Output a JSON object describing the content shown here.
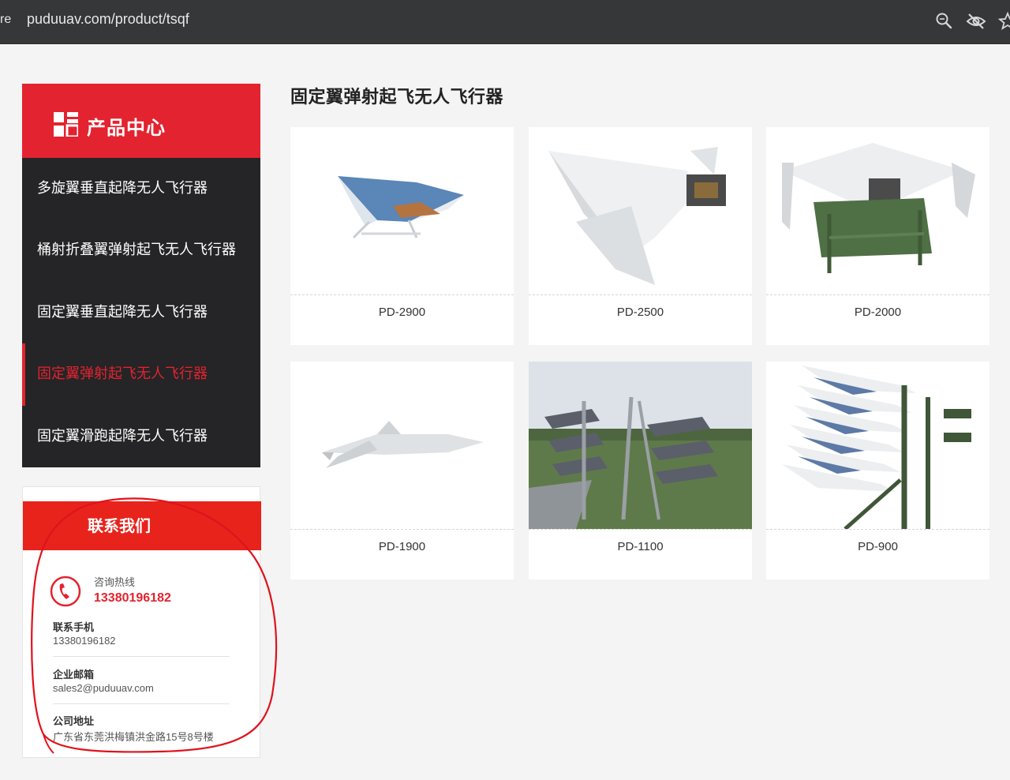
{
  "browser": {
    "url_fragment": "re",
    "url": "puduuav.com/product/tsqf",
    "icons": [
      "zoom-icon",
      "eye-off-icon",
      "bookmark-star-icon"
    ]
  },
  "sidebar": {
    "title": "产品中心",
    "items": [
      {
        "label": "多旋翼垂直起降无人飞行器",
        "active": false
      },
      {
        "label": "桶射折叠翼弹射起飞无人飞行器",
        "active": false
      },
      {
        "label": "固定翼垂直起降无人飞行器",
        "active": false
      },
      {
        "label": "固定翼弹射起飞无人飞行器",
        "active": true
      },
      {
        "label": "固定翼滑跑起降无人飞行器",
        "active": false
      }
    ]
  },
  "contact": {
    "title": "联系我们",
    "hotline_label": "咨询热线",
    "hotline": "13380196182",
    "fields": [
      {
        "label": "联系手机",
        "value": "13380196182"
      },
      {
        "label": "企业邮箱",
        "value": "sales2@puduuav.com"
      },
      {
        "label": "公司地址",
        "value": "广东省东莞洪梅镇洪金路15号8号楼"
      }
    ]
  },
  "main": {
    "title": "固定翼弹射起飞无人飞行器",
    "products": [
      {
        "name": "PD-2900"
      },
      {
        "name": "PD-2500"
      },
      {
        "name": "PD-2000"
      },
      {
        "name": "PD-1900"
      },
      {
        "name": "PD-1100"
      },
      {
        "name": "PD-900"
      }
    ]
  },
  "colors": {
    "accent": "#e3232f",
    "sidebar_bg": "#252426",
    "browser_bg": "#353739",
    "annotation": "#e0121c"
  }
}
